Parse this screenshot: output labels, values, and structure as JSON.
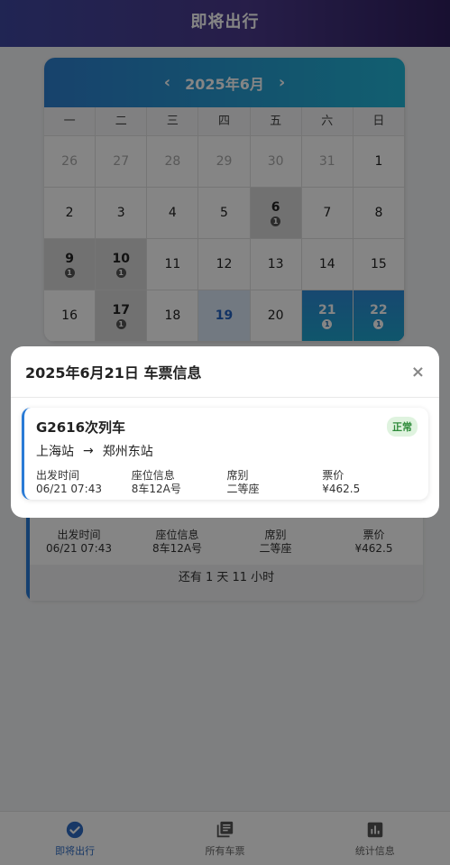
{
  "header": {
    "title": "即将出行"
  },
  "calendar": {
    "prev": "‹",
    "month_label": "2025年6月",
    "next": "›",
    "weekdays": [
      "一",
      "二",
      "三",
      "四",
      "五",
      "六",
      "日"
    ],
    "days": [
      {
        "n": "26",
        "other": true
      },
      {
        "n": "27",
        "other": true
      },
      {
        "n": "28",
        "other": true
      },
      {
        "n": "29",
        "other": true
      },
      {
        "n": "30",
        "other": true
      },
      {
        "n": "31",
        "other": true
      },
      {
        "n": "1"
      },
      {
        "n": "2"
      },
      {
        "n": "3"
      },
      {
        "n": "4"
      },
      {
        "n": "5"
      },
      {
        "n": "6",
        "count": "1"
      },
      {
        "n": "7"
      },
      {
        "n": "8"
      },
      {
        "n": "9",
        "count": "1"
      },
      {
        "n": "10",
        "count": "1"
      },
      {
        "n": "11"
      },
      {
        "n": "12"
      },
      {
        "n": "13"
      },
      {
        "n": "14"
      },
      {
        "n": "15"
      },
      {
        "n": "16"
      },
      {
        "n": "17",
        "count": "1"
      },
      {
        "n": "18"
      },
      {
        "n": "19",
        "today": true
      },
      {
        "n": "20"
      },
      {
        "n": "21",
        "count": "1",
        "selected": true
      },
      {
        "n": "22",
        "count": "1",
        "selected": true
      }
    ]
  },
  "background_card": {
    "info": [
      {
        "label": "出发时间",
        "value": "06/21 07:43"
      },
      {
        "label": "座位信息",
        "value": "8车12A号"
      },
      {
        "label": "席别",
        "value": "二等座"
      },
      {
        "label": "票价",
        "value": "¥462.5"
      }
    ],
    "countdown": "还有 1 天 11 小时"
  },
  "modal": {
    "title": "2025年6月21日 车票信息",
    "close": "×",
    "ticket": {
      "train": "G2616次列车",
      "status": "正常",
      "from": "上海站",
      "arrow": "→",
      "to": "郑州东站",
      "info": [
        {
          "label": "出发时间",
          "value": "06/21 07:43"
        },
        {
          "label": "座位信息",
          "value": "8车12A号"
        },
        {
          "label": "席别",
          "value": "二等座"
        },
        {
          "label": "票价",
          "value": "¥462.5"
        }
      ]
    }
  },
  "tabbar": {
    "items": [
      {
        "label": "即将出行",
        "icon": "check-circle-icon",
        "active": true
      },
      {
        "label": "所有车票",
        "icon": "library-icon"
      },
      {
        "label": "统计信息",
        "icon": "bar-chart-icon"
      }
    ]
  },
  "colors": {
    "accent": "#2f6cc4",
    "header_start": "#3f47a0",
    "header_end": "#2f1f5e",
    "status_green": "#2e8b3a"
  }
}
